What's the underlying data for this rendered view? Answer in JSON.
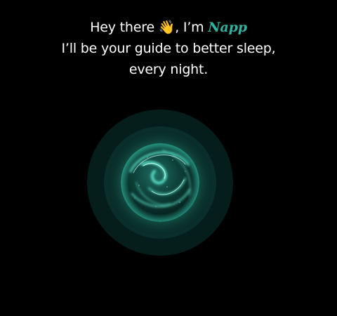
{
  "greeting": {
    "prefix": "Hey there",
    "wave_emoji": "👋",
    "im": ", I’m",
    "brand": "Napp",
    "line2": "I’ll be your guide to better sleep,",
    "line3": "every night."
  },
  "colors": {
    "background": "#000000",
    "text": "#ffffff",
    "brand": "#2fb3a0",
    "ring_outer": "#061e1b",
    "ring_inner": "#0a2e29",
    "orb_glow": "#3ee6c8"
  },
  "icons": {
    "wave": "waving-hand-icon",
    "orb": "glowing-orb-icon"
  }
}
